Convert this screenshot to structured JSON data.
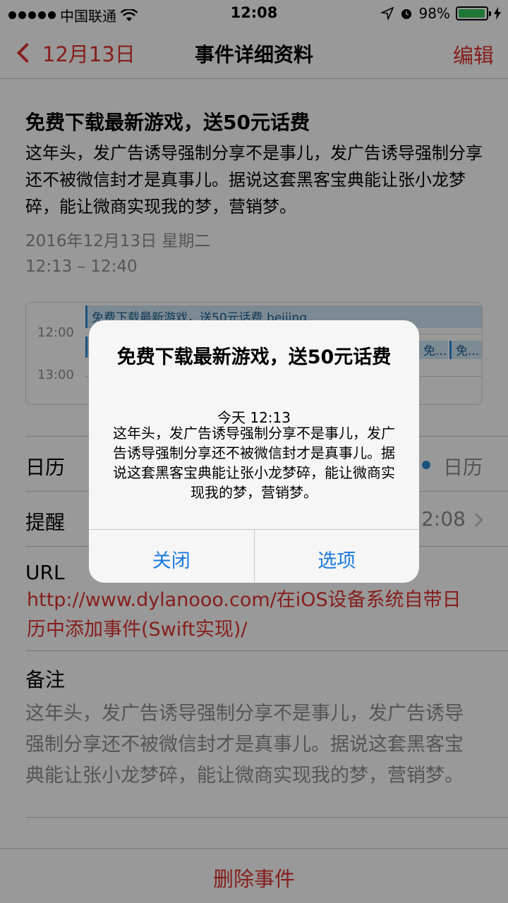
{
  "status": {
    "carrier": "中国联通",
    "time": "12:08",
    "battery": "98%",
    "battery_level": 0.98,
    "battery_color": "#34c759"
  },
  "nav": {
    "back_label": "12月13日",
    "title": "事件详细资料",
    "edit_label": "编辑",
    "accent": "#e0332f"
  },
  "event": {
    "title": "免费下载最新游戏，送50元话费",
    "description": "这年头，发广告诱导强制分享不是事儿，发广告诱导强制分享还不被微信封才是真事儿。据说这套黑客宝典能让张小龙梦碎，能让微商实现我的梦，营销梦。",
    "date": "2016年12月13日 星期二",
    "time_range": "12:13 – 12:40"
  },
  "mini_calendar": {
    "hours": [
      "12:00",
      "13:00"
    ],
    "main_event": "免费下载最新游戏，送50元话费 beijing",
    "overlap_events": [
      "免...",
      "免..."
    ]
  },
  "rows": {
    "calendar_label": "日历",
    "calendar_value": "日历",
    "calendar_dot_color": "#2a8ad4",
    "alert_label": "提醒",
    "alert_value": "2:08",
    "url_label": "URL",
    "url_value": "http://www.dylanooo.com/在iOS设备系统自带日历中添加事件(Swift实现)/",
    "notes_label": "备注",
    "notes_value": "这年头，发广告诱导强制分享不是事儿，发广告诱导强制分享还不被微信封才是真事儿。据说这套黑客宝典能让张小龙梦碎，能让微商实现我的梦，营销梦。"
  },
  "delete_label": "删除事件",
  "alert": {
    "title": "免费下载最新游戏，送50元话费",
    "time": "今天 12:13",
    "body": "这年头，发广告诱导强制分享不是事儿，发广告诱导强制分享还不被微信封才是真事儿。据说这套黑客宝典能让张小龙梦碎，能让微商实现我的梦，营销梦。",
    "close_label": "关闭",
    "options_label": "选项",
    "button_color": "#1a7ae0"
  }
}
